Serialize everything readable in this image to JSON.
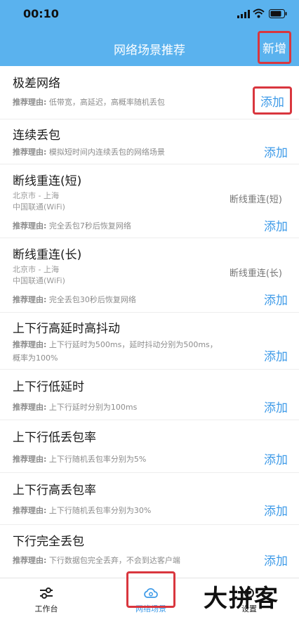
{
  "status_bar": {
    "time": "00:10"
  },
  "header": {
    "title": "网络场景推荐",
    "add_label": "新增"
  },
  "add_label": "添加",
  "items": [
    {
      "title": "极差网络",
      "reason_label": "推荐理由:",
      "reason": "低带宽，高延迟，高概率随机丢包"
    },
    {
      "title": "连续丢包",
      "reason_label": "推荐理由:",
      "reason": "模拟短时间内连续丢包的网络场景"
    },
    {
      "title": "断线重连(短)",
      "location": "北京市 - 上海",
      "carrier": "中国联通(WiFi)",
      "tag": "断线重连(短)",
      "reason_label": "推荐理由:",
      "reason": "完全丢包7秒后恢复网络"
    },
    {
      "title": "断线重连(长)",
      "location": "北京市 - 上海",
      "carrier": "中国联通(WiFi)",
      "tag": "断线重连(长)",
      "reason_label": "推荐理由:",
      "reason": "完全丢包30秒后恢复网络"
    },
    {
      "title": "上下行高延时高抖动",
      "reason_label": "推荐理由:",
      "reason": "上下行延时为500ms，延时抖动分别为500ms，概率为100%"
    },
    {
      "title": "上下行低延时",
      "reason_label": "推荐理由:",
      "reason": "上下行延时分别为100ms"
    },
    {
      "title": "上下行低丢包率",
      "reason_label": "推荐理由:",
      "reason": "上下行随机丢包率分别为5%"
    },
    {
      "title": "上下行高丢包率",
      "reason_label": "推荐理由:",
      "reason": "上下行随机丢包率分别为30%"
    },
    {
      "title": "下行完全丢包",
      "reason_label": "推荐理由:",
      "reason": "下行数据包完全丢弃，不会到达客户端"
    }
  ],
  "tabbar": {
    "tabs": [
      {
        "label": "工作台",
        "icon": "sliders-icon"
      },
      {
        "label": "网络场景",
        "icon": "cloud-icon",
        "active": true
      },
      {
        "label": "设置",
        "icon": "gear-icon"
      }
    ]
  },
  "watermark": "大拼客",
  "colors": {
    "header": "#5ab2ee",
    "accent": "#3f9be8",
    "highlight_border": "#d9363e"
  }
}
